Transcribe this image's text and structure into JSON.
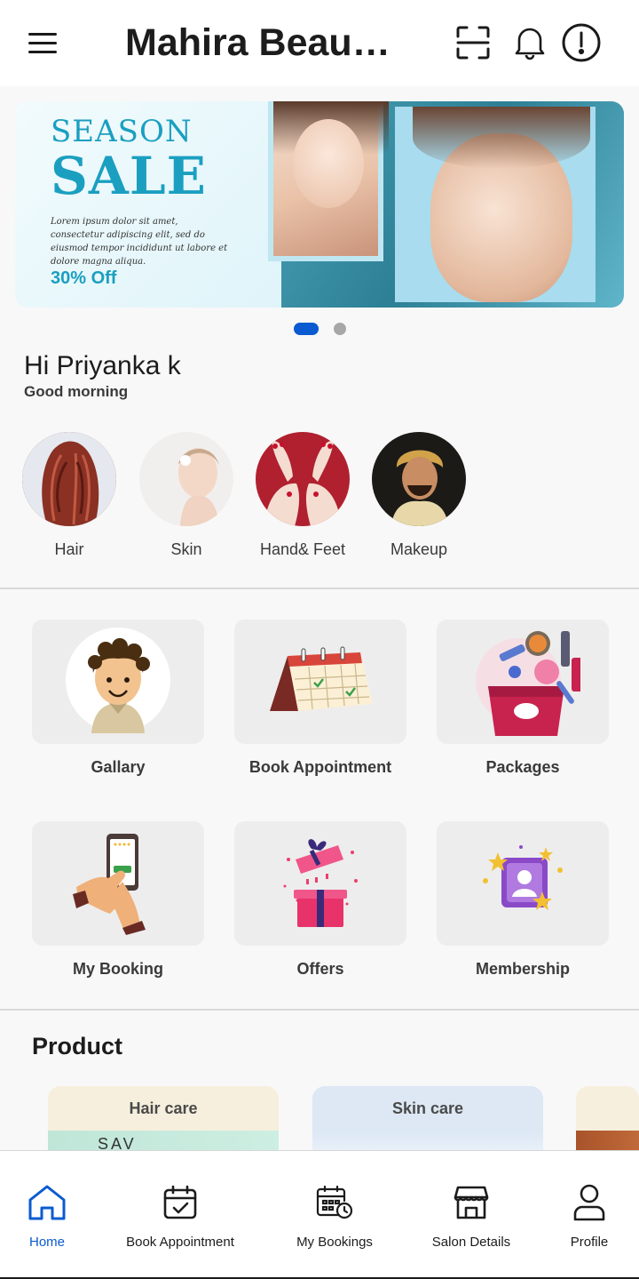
{
  "header": {
    "title": "Mahira Beau…",
    "menu_icon": "hamburger-menu-icon",
    "scan_icon": "scan-icon",
    "bell_icon": "bell-icon",
    "info_icon": "info-icon"
  },
  "banner": {
    "line1": "SEASON",
    "line2": "SALE",
    "description": "Lorem ipsum dolor sit amet, consectetur adipiscing elit, sed do eiusmod tempor incididunt ut labore et dolore magna aliqua.",
    "offer": "30% Off",
    "slide_count": 2,
    "active_slide": 1
  },
  "greeting": {
    "hello": "Hi Priyanka k",
    "sub": "Good morning"
  },
  "categories": [
    {
      "label": "Hair"
    },
    {
      "label": "Skin"
    },
    {
      "label": "Hand& Feet"
    },
    {
      "label": "Makeup"
    }
  ],
  "services": [
    {
      "label": "Gallary",
      "icon": "avatar-boy-icon"
    },
    {
      "label": "Book Appointment",
      "icon": "calendar-icon"
    },
    {
      "label": "Packages",
      "icon": "makeup-bag-icon"
    },
    {
      "label": "My Booking",
      "icon": "phone-booking-icon"
    },
    {
      "label": "Offers",
      "icon": "gift-box-icon"
    },
    {
      "label": "Membership",
      "icon": "membership-card-icon"
    }
  ],
  "product": {
    "title": "Product",
    "cards": [
      {
        "label": "Hair care"
      },
      {
        "label": "Skin care"
      },
      {
        "label": ""
      }
    ]
  },
  "bottom_nav": [
    {
      "label": "Home",
      "icon": "home-icon",
      "active": true
    },
    {
      "label": "Book Appointment",
      "icon": "calendar-check-icon",
      "active": false
    },
    {
      "label": "My Bookings",
      "icon": "calendar-clock-icon",
      "active": false
    },
    {
      "label": "Salon Details",
      "icon": "store-icon",
      "active": false
    },
    {
      "label": "Profile",
      "icon": "user-icon",
      "active": false
    }
  ],
  "colors": {
    "accent": "#0a5bd1",
    "banner_text": "#1a9fc0",
    "tile_bg": "#ededed"
  }
}
